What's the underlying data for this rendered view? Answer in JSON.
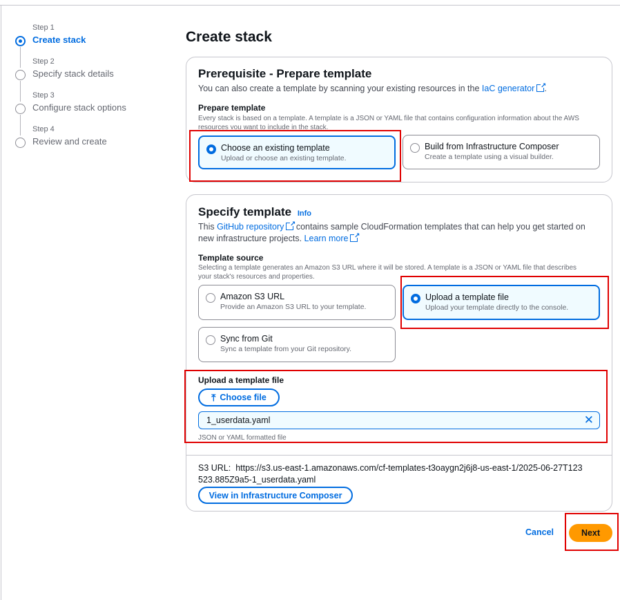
{
  "steps": [
    {
      "num": "Step 1",
      "label": "Create stack"
    },
    {
      "num": "Step 2",
      "label": "Specify stack details"
    },
    {
      "num": "Step 3",
      "label": "Configure stack options"
    },
    {
      "num": "Step 4",
      "label": "Review and create"
    }
  ],
  "page_title": "Create stack",
  "prereq": {
    "title": "Prerequisite - Prepare template",
    "desc_prefix": "You can also create a template by scanning your existing resources in the ",
    "desc_link": "IaC generator",
    "desc_suffix": ".",
    "field_label": "Prepare template",
    "field_help": "Every stack is based on a template. A template is a JSON or YAML file that contains configuration information about the AWS resources you want to include in the stack.",
    "options": [
      {
        "title": "Choose an existing template",
        "sub": "Upload or choose an existing template."
      },
      {
        "title": "Build from Infrastructure Composer",
        "sub": "Create a template using a visual builder."
      }
    ]
  },
  "specify": {
    "title": "Specify template",
    "info": "Info",
    "desc_prefix": "This ",
    "desc_link1": "GitHub repository",
    "desc_mid": " contains sample CloudFormation templates that can help you get started on new infrastructure projects. ",
    "desc_link2": "Learn more",
    "source_label": "Template source",
    "source_help": "Selecting a template generates an Amazon S3 URL where it will be stored. A template is a JSON or YAML file that describes your stack's resources and properties.",
    "options": [
      {
        "title": "Amazon S3 URL",
        "sub": "Provide an Amazon S3 URL to your template."
      },
      {
        "title": "Upload a template file",
        "sub": "Upload your template directly to the console."
      },
      {
        "title": "Sync from Git",
        "sub": "Sync a template from your Git repository."
      }
    ],
    "upload_label": "Upload a template file",
    "choose_file": "Choose file",
    "file_name": "1_userdata.yaml",
    "file_help": "JSON or YAML formatted file",
    "s3_label": "S3 URL:",
    "s3_url": "https://s3.us-east-1.amazonaws.com/cf-templates-t3oaygn2j6j8-us-east-1/2025-06-27T123523.885Z9a5-1_userdata.yaml",
    "view_composer": "View in Infrastructure Composer"
  },
  "footer": {
    "cancel": "Cancel",
    "next": "Next"
  },
  "colors": {
    "accent": "#006ce0",
    "primary_button": "#ff9900",
    "highlight": "#e00000"
  }
}
